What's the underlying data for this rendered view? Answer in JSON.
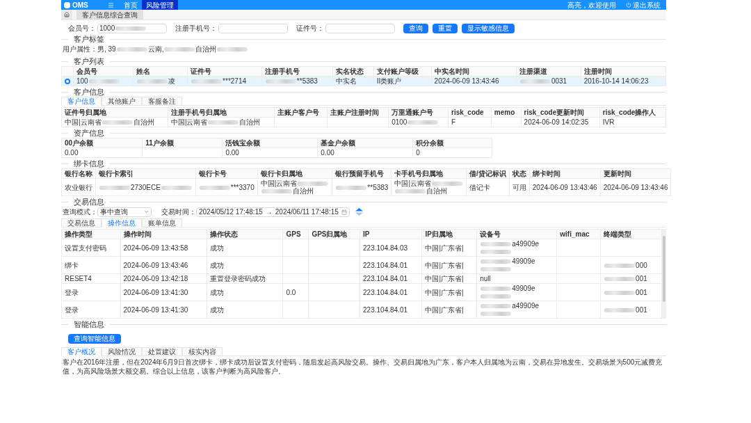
{
  "topbar": {
    "logo": "OMS",
    "nav": [
      {
        "label": "首页",
        "selected": false
      },
      {
        "label": "风险管理",
        "selected": true
      }
    ],
    "user": "高亮，欢迎使用",
    "logout": "退出系统"
  },
  "breadcrumb": "客户信息综合查询",
  "search": {
    "fields": [
      {
        "label": "会员号：",
        "value": [
          "1000",
          {
            "kind": "blur"
          }
        ]
      },
      {
        "label": "注册手机号："
      },
      {
        "label": "证件号："
      }
    ],
    "buttons": [
      "查询",
      "重置",
      "显示敏感信息"
    ]
  },
  "tag_section": {
    "title": "客户标签",
    "attributes": [
      "用户属性：男, 39",
      {
        "kind": "blur"
      },
      "云南,",
      {
        "kind": "blur"
      },
      "自治州",
      {
        "kind": "blur"
      }
    ]
  },
  "customer_list": {
    "title": "客户列表",
    "columns": [
      "会员号",
      "姓名",
      "证件号",
      "注册手机号",
      "实名状态",
      "支付账户等级",
      "中实名时间",
      "注册渠道",
      "注册时间"
    ],
    "rows": [
      {
        "selected": true,
        "cells": [
          [
            "100",
            {
              "kind": "blur"
            }
          ],
          [
            {
              "kind": "blur"
            },
            "凌"
          ],
          [
            {
              "kind": "blur"
            },
            "***2714"
          ],
          [
            {
              "kind": "blur"
            },
            "**5383"
          ],
          "中实名",
          "II类账户",
          "2024-06-09 13:43:46",
          [
            {
              "kind": "blur"
            },
            "0031"
          ],
          "2016-10-14 14:06:23"
        ]
      }
    ]
  },
  "customer_info": {
    "title": "客户信息",
    "tabs": [
      {
        "label": "客户信息",
        "selected": true
      },
      {
        "label": "其他账户",
        "selected": false
      },
      {
        "label": "客服备注",
        "selected": false
      }
    ],
    "columns": [
      "证件号归属地",
      "注册手机号归属地",
      "主账户客户号",
      "主账户注册时间",
      "万里通账户号",
      "risk_code",
      "memo",
      "risk_code更新时间",
      "risk_code操作人"
    ],
    "rows": [
      [
        [
          "中国|云南省",
          {
            "kind": "blur"
          },
          "自治州"
        ],
        [
          "中国|云南省",
          {
            "kind": "blur"
          },
          "自治州"
        ],
        null,
        null,
        [
          "0100",
          {
            "kind": "blur"
          }
        ],
        "F",
        null,
        "2024-06-09 14:02:35",
        "IVR"
      ]
    ]
  },
  "assets": {
    "title": "资产信息",
    "columns": [
      "00户余额",
      "11户余额",
      "活钱宝余额",
      "基金户余额",
      "积分余额"
    ],
    "rows": [
      [
        "0.00",
        null,
        "0.00",
        "0.00",
        "0"
      ]
    ]
  },
  "bank_cards": {
    "title": "绑卡信息",
    "columns": [
      "银行名称",
      "银行卡索引",
      "银行卡号",
      "银行卡归属地",
      "银行预留手机号",
      "卡手机号归属地",
      "借/贷记标识",
      "状态",
      "绑卡时间",
      "更新时间"
    ],
    "rows": [
      [
        "农业银行",
        [
          {
            "kind": "blur"
          },
          "2730ECE",
          {
            "kind": "blur"
          }
        ],
        [
          {
            "kind": "blur"
          },
          "***3370"
        ],
        [
          "中国|云南省",
          {
            "kind": "blur"
          },
          {
            "kind": "break"
          },
          {
            "kind": "blur"
          },
          "自治州"
        ],
        [
          {
            "kind": "blur"
          },
          "**5383"
        ],
        [
          "中国|云南省",
          {
            "kind": "blur"
          },
          {
            "kind": "break"
          },
          {
            "kind": "blur"
          },
          "自治州"
        ],
        "借记卡",
        "可用",
        "2024-06-09 13:43:46",
        "2024-06-09 13:43:46"
      ]
    ]
  },
  "transactions": {
    "title": "交易信息",
    "filter": {
      "mode_label": "查询模式：",
      "mode_value": "事中查询",
      "time_label": "交易时间：",
      "start": "2024/05/12 17:48:15",
      "separator": "→",
      "end": "2024/06/11 17:48:15"
    },
    "tabs": [
      {
        "label": "交易信息",
        "selected": false
      },
      {
        "label": "操作信息",
        "selected": true
      },
      {
        "label": "账单信息",
        "selected": false
      }
    ],
    "columns": [
      "操作类型",
      "操作时间",
      "操作状态",
      "GPS",
      "GPS归属地",
      "IP",
      "IP归属地",
      "设备号",
      "wifi_mac",
      "终端类型"
    ],
    "rows": [
      [
        "设置支付密码",
        "2024-06-09 13:43:58",
        "成功",
        null,
        null,
        "223.104.84.03",
        "中国|广东省|",
        [
          {
            "kind": "blur"
          },
          "a49909e",
          {
            "kind": "break"
          },
          {
            "kind": "blur"
          }
        ],
        null,
        null
      ],
      [
        "绑卡",
        "2024-06-09 13:43:46",
        "成功",
        null,
        null,
        "223.104.84.01",
        "中国|广东省|",
        [
          {
            "kind": "blur"
          },
          "49909e",
          {
            "kind": "break"
          },
          {
            "kind": "blur"
          }
        ],
        null,
        [
          {
            "kind": "blur"
          },
          "000"
        ]
      ],
      [
        "RESET4",
        "2024-06-09 13:42:18",
        "重置登录密码成功",
        null,
        null,
        "223.104.84.01",
        "中国|广东省|",
        "null",
        null,
        [
          {
            "kind": "blur"
          },
          "001"
        ]
      ],
      [
        "登录",
        "2024-06-09 13:41:30",
        "成功",
        "0.0",
        null,
        "223.104.84.01",
        "中国|广东省|",
        [
          {
            "kind": "blur"
          },
          "49909e",
          {
            "kind": "break"
          },
          {
            "kind": "blur"
          }
        ],
        null,
        [
          {
            "kind": "blur"
          },
          "001"
        ]
      ],
      [
        "登录",
        "2024-06-09 13:41:30",
        "成功",
        null,
        null,
        "223.104.84.01",
        "中国|广东省|",
        [
          {
            "kind": "blur"
          },
          "a49909e",
          {
            "kind": "break"
          },
          {
            "kind": "blur"
          }
        ],
        null,
        [
          {
            "kind": "blur"
          },
          "001"
        ]
      ]
    ]
  },
  "smart_info": {
    "title": "智能信息",
    "button": "查询智能信息",
    "tabs": [
      {
        "label": "客户概况",
        "selected": true
      },
      {
        "label": "风险情况",
        "selected": false
      },
      {
        "label": "处置建议",
        "selected": false
      },
      {
        "label": "核实内容",
        "selected": false
      }
    ],
    "text": "客户在2016年注册，但在2024年6月9日首次绑卡，绑卡成功后设置支付密码，随后发起高风险交易。操作、交易归属地为广东，客户本人归属地为云南，交易在异地发生。交易场景为500元减费充值，为高风险场景大额交易。综合以上信息，该客户判断为高风险客户。"
  }
}
